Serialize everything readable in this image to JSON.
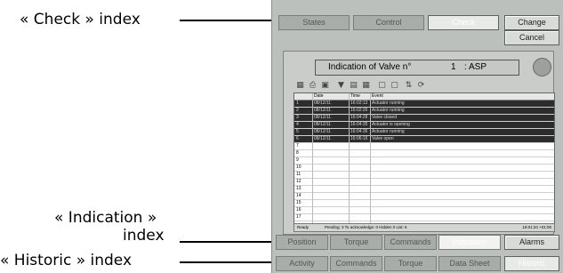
{
  "annotations": {
    "check": "« Check » index",
    "indication_line1": "« Indication »",
    "indication_line2": "index",
    "historic": "« Historic » index"
  },
  "top_tabs": [
    "States",
    "Control",
    "Check"
  ],
  "buttons": {
    "change": "Change",
    "cancel": "Cancel"
  },
  "panel": {
    "title_label": "Indication of Valve n°",
    "valve_number": "1",
    "valve_name": ": ASP"
  },
  "grid": {
    "headers": {
      "date": "Date",
      "time": "Time",
      "event": "Event"
    },
    "rows": [
      {
        "n": "1",
        "date": "08/12/11",
        "time": "16:02:13",
        "event": "Actuator running"
      },
      {
        "n": "2",
        "date": "08/12/11",
        "time": "16:02:26",
        "event": "Actuator running"
      },
      {
        "n": "3",
        "date": "08/12/11",
        "time": "16:04:28",
        "event": "Valve closed"
      },
      {
        "n": "4",
        "date": "08/12/11",
        "time": "16:04:35",
        "event": "Actuator is opening"
      },
      {
        "n": "5",
        "date": "08/12/11",
        "time": "16:04:36",
        "event": "Actuator running"
      },
      {
        "n": "6",
        "date": "08/12/11",
        "time": "16:06:16",
        "event": "Valve open"
      },
      {
        "n": "7"
      },
      {
        "n": "8"
      },
      {
        "n": "9"
      },
      {
        "n": "10"
      },
      {
        "n": "11"
      },
      {
        "n": "12"
      },
      {
        "n": "13"
      },
      {
        "n": "14"
      },
      {
        "n": "15"
      },
      {
        "n": "16"
      },
      {
        "n": "17"
      }
    ]
  },
  "status": {
    "ready": "Ready",
    "info": "Pending: 3  To acknowledge: 0  Hidden 0  List: 6",
    "clock": "16:01:34 +01:00"
  },
  "bottom_tabs_1": [
    "Position",
    "Torque",
    "Commands",
    "Indication",
    "Alarms"
  ],
  "bottom_tabs_2": [
    "Activity",
    "Commands",
    "Torque",
    "Data Sheet",
    "Historic"
  ]
}
